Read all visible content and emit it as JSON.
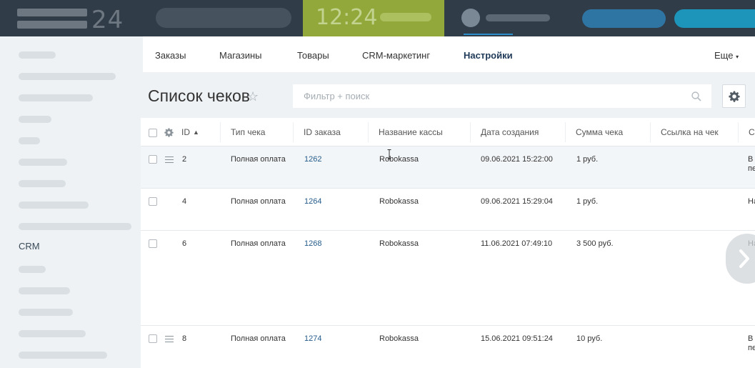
{
  "header": {
    "logo_text": "24",
    "clock": "12:24"
  },
  "leftmenu": {
    "active_item": "CRM"
  },
  "tabs": [
    {
      "label": "Заказы"
    },
    {
      "label": "Магазины"
    },
    {
      "label": "Товары"
    },
    {
      "label": "CRM-маркетинг"
    },
    {
      "label": "Настройки"
    }
  ],
  "tabs_more": "Еще",
  "page": {
    "title": "Список чеков",
    "filter_placeholder": "Фильтр + поиск"
  },
  "grid": {
    "columns": [
      "ID",
      "Тип чека",
      "ID заказа",
      "Название кассы",
      "Дата создания",
      "Сумма чека",
      "Ссылка на чек",
      "С"
    ],
    "rows": [
      {
        "id": "2",
        "type": "Полная оплата",
        "order_id": "1262",
        "cashbox": "Robokassa",
        "created": "09.06.2021 15:22:00",
        "sum": "1 руб.",
        "link": "",
        "status": "В",
        "status2": "пе"
      },
      {
        "id": "4",
        "type": "Полная оплата",
        "order_id": "1264",
        "cashbox": "Robokassa",
        "created": "09.06.2021 15:29:04",
        "sum": "1 руб.",
        "link": "",
        "status": "На",
        "status2": ""
      },
      {
        "id": "6",
        "type": "Полная оплата",
        "order_id": "1268",
        "cashbox": "Robokassa",
        "created": "11.06.2021 07:49:10",
        "sum": "3 500 руб.",
        "link": "",
        "status": "На",
        "status2": ""
      },
      {
        "id": "8",
        "type": "Полная оплата",
        "order_id": "1274",
        "cashbox": "Robokassa",
        "created": "15.06.2021 09:51:24",
        "sum": "10 руб.",
        "link": "",
        "status": "В",
        "status2": "пе"
      }
    ]
  },
  "colors": {
    "topbar": "#303c48",
    "clock_bg": "#93a83a",
    "accent": "#2c8ec8",
    "link": "#245b8b"
  }
}
